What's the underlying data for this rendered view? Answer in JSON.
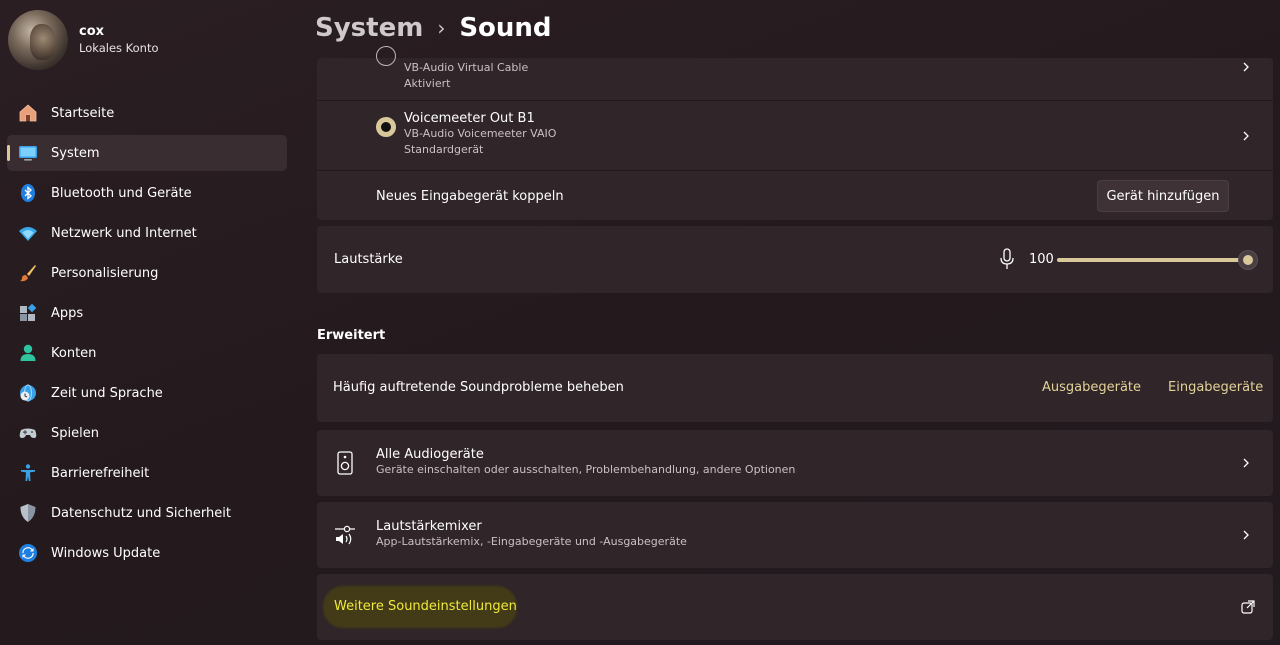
{
  "profile": {
    "name": "cox",
    "account": "Lokales Konto"
  },
  "breadcrumb": {
    "parent": "System",
    "separator": "›",
    "current": "Sound"
  },
  "sidebar": {
    "items": [
      {
        "label": "Startseite",
        "icon": "home-icon"
      },
      {
        "label": "System",
        "icon": "monitor-icon",
        "active": true
      },
      {
        "label": "Bluetooth und Geräte",
        "icon": "bluetooth-icon"
      },
      {
        "label": "Netzwerk und Internet",
        "icon": "wifi-icon"
      },
      {
        "label": "Personalisierung",
        "icon": "brush-icon"
      },
      {
        "label": "Apps",
        "icon": "apps-icon"
      },
      {
        "label": "Konten",
        "icon": "person-icon"
      },
      {
        "label": "Zeit und Sprache",
        "icon": "globe-clock-icon"
      },
      {
        "label": "Spielen",
        "icon": "gamepad-icon"
      },
      {
        "label": "Barrierefreiheit",
        "icon": "accessibility-icon"
      },
      {
        "label": "Datenschutz und Sicherheit",
        "icon": "shield-icon"
      },
      {
        "label": "Windows Update",
        "icon": "update-icon"
      }
    ]
  },
  "input_devices": [
    {
      "name": "",
      "sub1": "VB-Audio Virtual Cable",
      "sub2": "Aktiviert",
      "selected": false
    },
    {
      "name": "Voicemeeter Out B1",
      "sub1": "VB-Audio Voicemeeter VAIO",
      "sub2": "Standardgerät",
      "selected": true
    }
  ],
  "pair": {
    "label": "Neues Eingabegerät koppeln",
    "button": "Gerät hinzufügen"
  },
  "volume": {
    "label": "Lautstärke",
    "value": "100",
    "level_percent": 100,
    "icon": "microphone-icon"
  },
  "advanced": {
    "title": "Erweitert",
    "troubleshoot": {
      "label": "Häufig auftretende Soundprobleme beheben",
      "link_output": "Ausgabegeräte",
      "link_input": "Eingabegeräte"
    },
    "all_devices": {
      "title": "Alle Audiogeräte",
      "sub": "Geräte einschalten oder ausschalten, Problembehandlung, andere Optionen",
      "icon": "speaker-icon"
    },
    "mixer": {
      "title": "Lautstärkemixer",
      "sub": "App-Lautstärkemix, -Eingabegeräte und -Ausgabegeräte",
      "icon": "mixer-icon"
    },
    "more": {
      "label": "Weitere Soundeinstellungen",
      "icon": "external-link-icon"
    }
  },
  "colors": {
    "accent": "#d9c89a",
    "link": "#e2d29a",
    "highlight_text": "#f0ea3a"
  }
}
